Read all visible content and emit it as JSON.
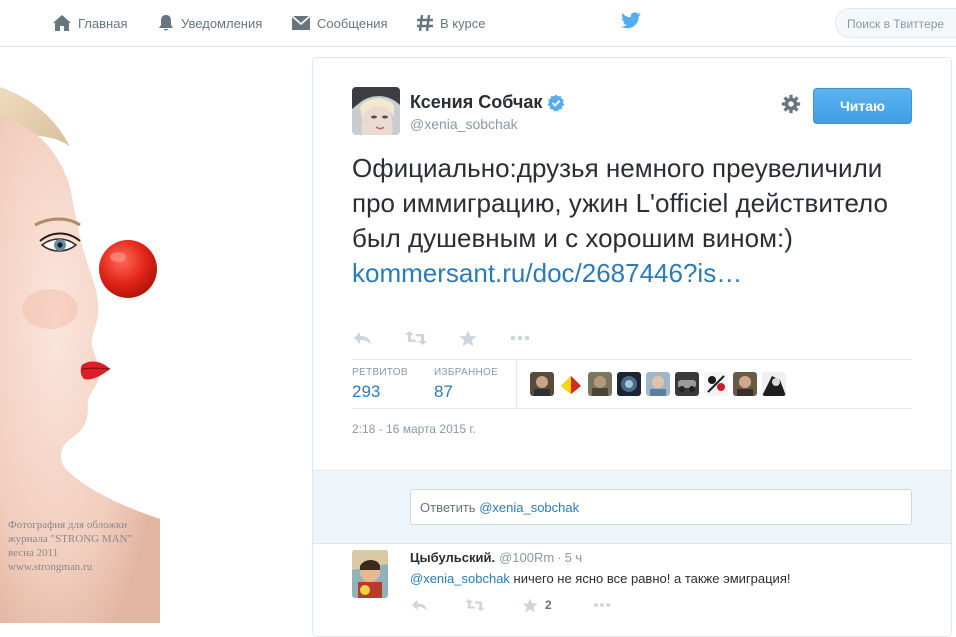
{
  "nav": {
    "items": [
      {
        "label": "Главная",
        "icon": "home-icon"
      },
      {
        "label": "Уведомления",
        "icon": "bell-icon"
      },
      {
        "label": "Сообщения",
        "icon": "envelope-icon"
      },
      {
        "label": "В курсе",
        "icon": "hashtag-icon"
      }
    ],
    "logo": "twitter-bird-icon",
    "search_placeholder": "Поиск в Твиттере"
  },
  "photo": {
    "caption_lines": [
      "Фотография для обложки",
      "журнала \"STRONG MAN\"",
      "весна 2011",
      "www.strongman.ru"
    ]
  },
  "tweet": {
    "author_name": "Ксения Собчак",
    "author_handle": "@xenia_sobchak",
    "verified": true,
    "follow_label": "Читаю",
    "text": "Официально:друзья немного преувеличили про иммиграцию, ужин L'officiel действитело был душевным и с хорошим вином:)",
    "link": "kommersant.ru/doc/2687446?is…",
    "stats": {
      "retweets_label": "РЕТВИТОВ",
      "retweets_value": "293",
      "favorites_label": "ИЗБРАННОЕ",
      "favorites_value": "87"
    },
    "timestamp": "2:18 - 16 марта 2015 г.",
    "reply_placeholder_prefix": "Ответить ",
    "reply_placeholder_mention": "@xenia_sobchak"
  },
  "reply": {
    "name": "Цыбульский.",
    "handle": "@100Rm",
    "dot": "·",
    "time": "5 ч",
    "mention": "@xenia_sobchak",
    "text": " ничего не ясно все равно! а также эмиграция!",
    "favorite_count": "2"
  },
  "colors": {
    "accent": "#55acee",
    "link": "#2b7bb9",
    "muted": "#8899a6",
    "text": "#292f33"
  }
}
